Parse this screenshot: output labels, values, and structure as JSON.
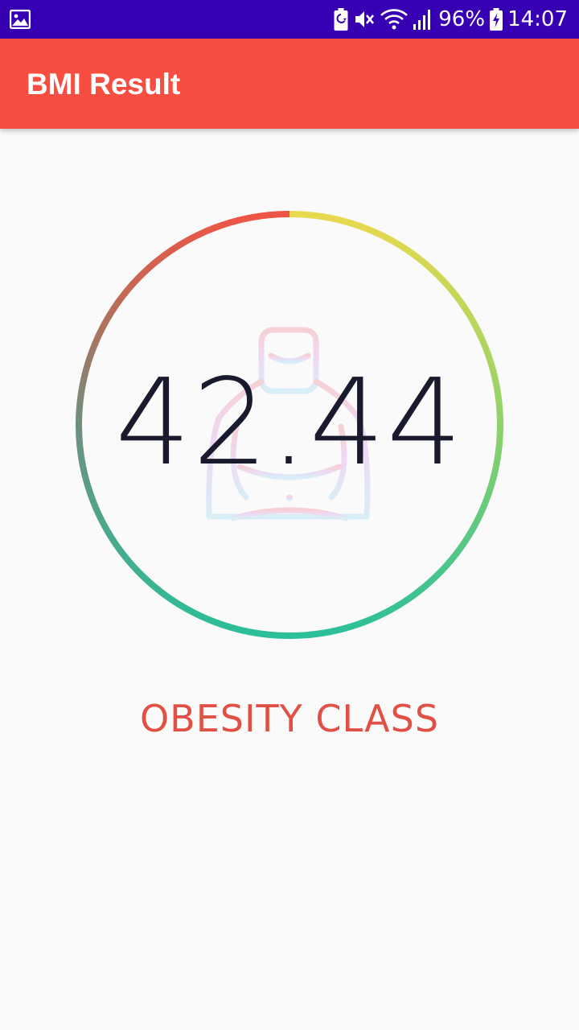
{
  "status_bar": {
    "battery_percent": "96%",
    "time": "14:07",
    "icons": [
      "gallery-icon",
      "battery-saver-icon",
      "mute-icon",
      "wifi-icon",
      "signal-icon",
      "battery-charging-icon"
    ]
  },
  "app_bar": {
    "title": "BMI Result",
    "background": "#f84e42"
  },
  "result": {
    "bmi_value": "42.44",
    "category": "OBESITY CLASS",
    "category_color": "#e05045",
    "gauge_colors": [
      "#e9d94e",
      "#8fd26a",
      "#2bbf9a",
      "#6e8f7e",
      "#c06a55",
      "#ef5446"
    ]
  }
}
